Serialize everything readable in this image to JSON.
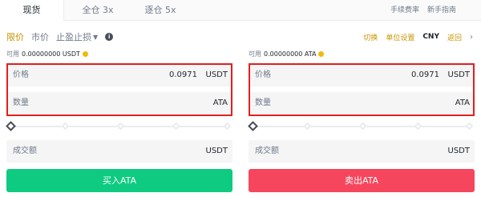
{
  "tabs": [
    {
      "label": "现货"
    },
    {
      "label": "全仓 3x"
    },
    {
      "label": "逐仓 5x"
    }
  ],
  "top_links": {
    "fee": "手续费率",
    "guide": "新手指南"
  },
  "order_types": {
    "limit": "限价",
    "market": "市价",
    "stop": "止盈止损"
  },
  "right_options": {
    "opt1": "切换",
    "opt2": "单位设置",
    "currency": "CNY",
    "opt3": "返回"
  },
  "buy": {
    "avail_label": "可用",
    "avail_value": "0.00000000 USDT",
    "price_label": "价格",
    "price_value": "0.0971",
    "price_unit": "USDT",
    "amount_label": "数量",
    "amount_unit": "ATA",
    "total_label": "成交额",
    "total_unit": "USDT",
    "button": "买入ATA"
  },
  "sell": {
    "avail_label": "可用",
    "avail_value": "0.00000000 ATA",
    "price_label": "价格",
    "price_value": "0.0971",
    "price_unit": "USDT",
    "amount_label": "数量",
    "amount_unit": "ATA",
    "total_label": "成交额",
    "total_unit": "USDT",
    "button": "卖出ATA"
  },
  "colors": {
    "accent": "#f0b90b",
    "buy": "#0ecb81",
    "sell": "#f6465d",
    "highlight": "#e02020"
  }
}
